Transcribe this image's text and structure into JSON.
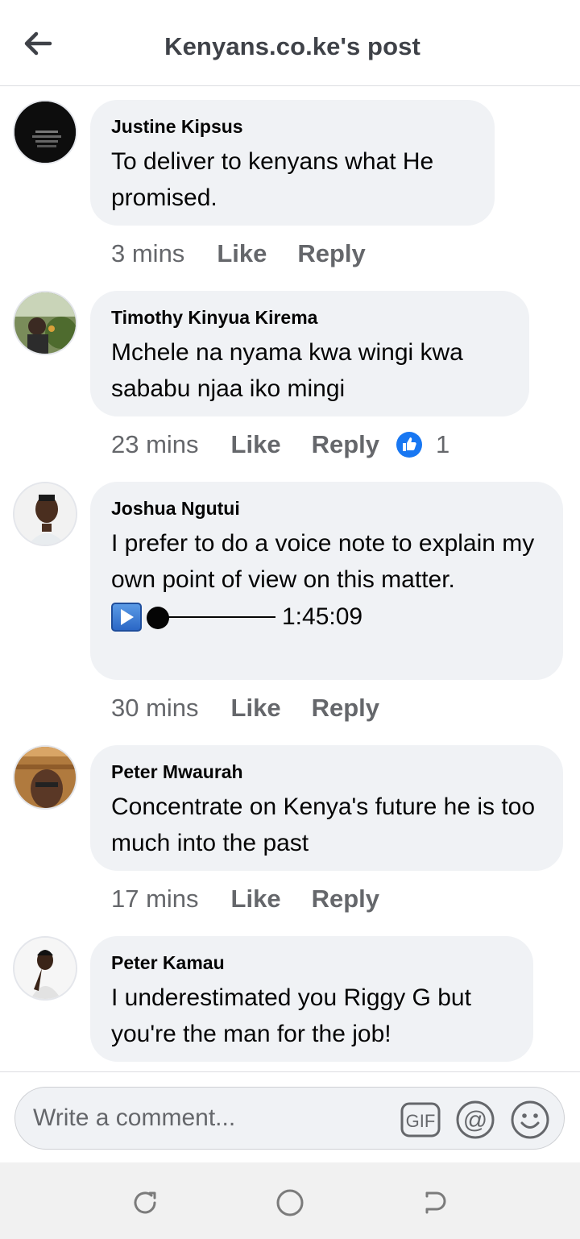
{
  "header": {
    "title": "Kenyans.co.ke's post",
    "back_icon": "arrow-left-icon"
  },
  "comments": [
    {
      "author": "Justine Kipsus",
      "text": "To deliver to kenyans what He promised.",
      "time": "3 mins",
      "like_label": "Like",
      "reply_label": "Reply"
    },
    {
      "author": "Timothy Kinyua Kirema",
      "text": "Mchele na nyama kwa wingi kwa sababu njaa iko mingi",
      "time": "23 mins",
      "like_label": "Like",
      "reply_label": "Reply",
      "reaction_icon": "like-reaction-icon",
      "reaction_count": "1"
    },
    {
      "author": "Joshua Ngutui",
      "text": "I prefer to do a voice note to explain my own point of view on this matter.",
      "voice_duration": "1:45:09",
      "time": "30 mins",
      "like_label": "Like",
      "reply_label": "Reply"
    },
    {
      "author": "Peter Mwaurah",
      "text": "Concentrate on Kenya's future he is too much into the past",
      "time": "17 mins",
      "like_label": "Like",
      "reply_label": "Reply"
    },
    {
      "author": "Peter Kamau",
      "text": "I underestimated you Riggy G but you're the man for the job!"
    }
  ],
  "composer": {
    "placeholder": "Write a comment...",
    "value": "",
    "gif_label": "GIF",
    "mention_label": "@",
    "emoji_icon": "smiley-icon"
  },
  "nav": {
    "recents_icon": "recent-apps-icon",
    "home_icon": "home-icon",
    "back_icon": "back-icon"
  },
  "colors": {
    "bubble": "#f0f2f5",
    "secondary_text": "#65676b",
    "like_blue": "#1877f2"
  }
}
